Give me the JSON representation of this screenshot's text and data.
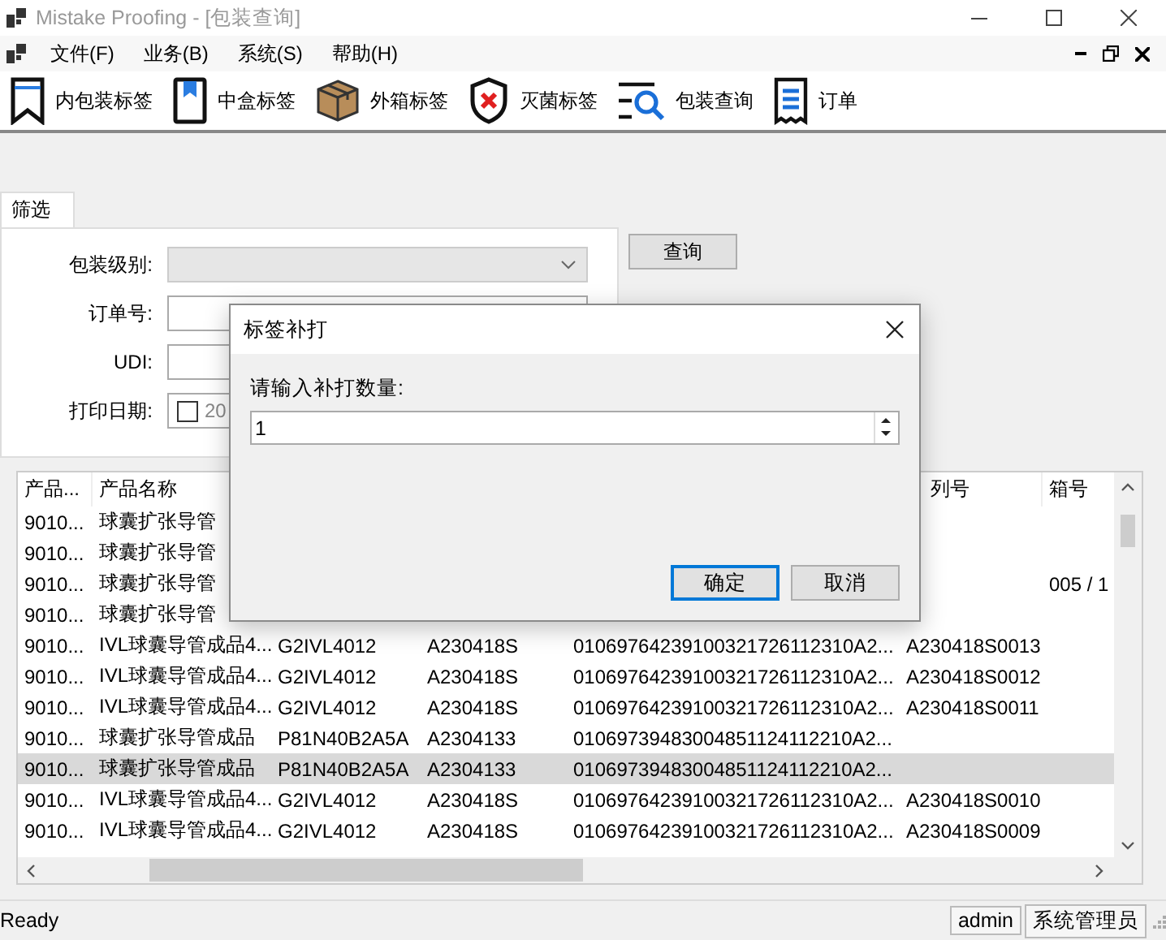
{
  "window": {
    "title": "Mistake Proofing - [包装查询]"
  },
  "menu": [
    "文件(F)",
    "业务(B)",
    "系统(S)",
    "帮助(H)"
  ],
  "toolbar": [
    {
      "kind": "bookmark",
      "label": "内包装标签"
    },
    {
      "kind": "tag",
      "label": "中盒标签"
    },
    {
      "kind": "box",
      "label": "外箱标签"
    },
    {
      "kind": "shield",
      "label": "灭菌标签"
    },
    {
      "kind": "search",
      "label": "包装查询"
    },
    {
      "kind": "document",
      "label": "订单"
    }
  ],
  "filter": {
    "tab": {
      "label": "筛选",
      "selected": true
    },
    "fields": [
      {
        "kind": "combo",
        "label": "包装级别:",
        "disabled": true
      },
      {
        "kind": "text",
        "label": "订单号:"
      },
      {
        "kind": "text",
        "label": "UDI:"
      },
      {
        "kind": "date",
        "label": "打印日期:",
        "checked": false,
        "value": "20"
      }
    ],
    "query_button": "查询"
  },
  "table": {
    "columns": [
      "产品...",
      "产品名称",
      null,
      null,
      null,
      "列号",
      "箱号"
    ],
    "rows": [
      {
        "selected": false,
        "cells": [
          "9010...",
          "球囊扩张导管",
          null,
          null,
          null,
          null,
          null
        ]
      },
      {
        "selected": false,
        "cells": [
          "9010...",
          "球囊扩张导管",
          null,
          null,
          null,
          null,
          null
        ]
      },
      {
        "selected": false,
        "cells": [
          "9010...",
          "球囊扩张导管",
          null,
          null,
          null,
          null,
          "005 / 1"
        ]
      },
      {
        "selected": false,
        "cells": [
          "9010...",
          "球囊扩张导管",
          null,
          null,
          null,
          null,
          null
        ]
      },
      {
        "selected": false,
        "cells": [
          "9010...",
          "IVL球囊导管成品4...",
          "G2IVL4012",
          "A230418S",
          "01069764239100321726112310A2...",
          "A230418S0013",
          null
        ]
      },
      {
        "selected": false,
        "cells": [
          "9010...",
          "IVL球囊导管成品4...",
          "G2IVL4012",
          "A230418S",
          "01069764239100321726112310A2...",
          "A230418S0012",
          null
        ]
      },
      {
        "selected": false,
        "cells": [
          "9010...",
          "IVL球囊导管成品4...",
          "G2IVL4012",
          "A230418S",
          "01069764239100321726112310A2...",
          "A230418S0011",
          null
        ]
      },
      {
        "selected": false,
        "cells": [
          "9010...",
          "球囊扩张导管成品",
          "P81N40B2A5A",
          "A2304133",
          "01069739483004851124112210A2...",
          null,
          null
        ]
      },
      {
        "selected": true,
        "cells": [
          "9010...",
          "球囊扩张导管成品",
          "P81N40B2A5A",
          "A2304133",
          "01069739483004851124112210A2...",
          null,
          null
        ]
      },
      {
        "selected": false,
        "cells": [
          "9010...",
          "IVL球囊导管成品4...",
          "G2IVL4012",
          "A230418S",
          "01069764239100321726112310A2...",
          "A230418S0010",
          null
        ]
      },
      {
        "selected": false,
        "cells": [
          "9010...",
          "IVL球囊导管成品4...",
          "G2IVL4012",
          "A230418S",
          "01069764239100321726112310A2...",
          "A230418S0009",
          null
        ]
      }
    ]
  },
  "status_bar": {
    "text": "Ready",
    "panels": [
      "admin",
      "系统管理员"
    ]
  },
  "dialog": {
    "title": "标签补打",
    "prompt": "请输入补打数量:",
    "value": "1",
    "buttons": [
      {
        "label": "确定",
        "default": true
      },
      {
        "label": "取消",
        "default": false
      }
    ]
  }
}
